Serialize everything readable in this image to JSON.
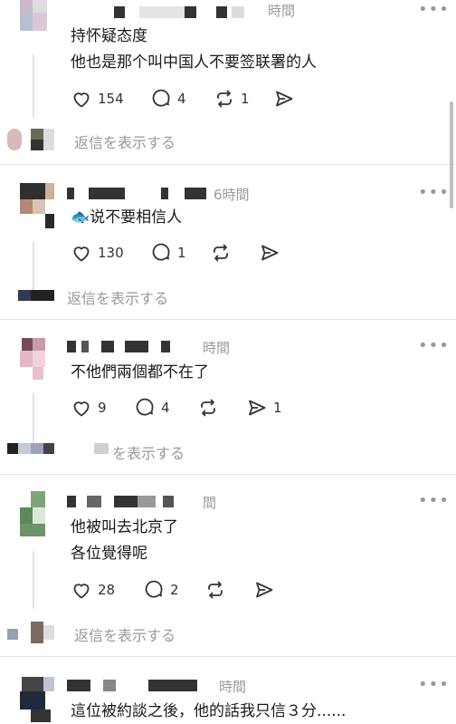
{
  "posts": [
    {
      "time": "時間",
      "text": [
        "持怀疑态度",
        "他也是那个叫中国人不要签联署的人"
      ],
      "likes": "154",
      "comments": "4",
      "reposts": "1",
      "shares": "",
      "reply": "返信を表示する"
    },
    {
      "time": "6時間",
      "text": [
        "🐟说不要相信人"
      ],
      "likes": "130",
      "comments": "1",
      "reposts": "",
      "shares": "",
      "reply": "返信を表示する"
    },
    {
      "time": "時間",
      "text": [
        "不他們兩個都不在了"
      ],
      "likes": "9",
      "comments": "4",
      "reposts": "",
      "shares": "1",
      "reply": "を表示する"
    },
    {
      "time": "間",
      "text": [
        "他被叫去北京了",
        "各位覺得呢"
      ],
      "likes": "28",
      "comments": "2",
      "reposts": "",
      "shares": "",
      "reply": "返信を表示する"
    },
    {
      "time": "時間",
      "text": [
        "這位被約談之後，他的話我只信３分......"
      ],
      "likes": "",
      "comments": "",
      "reposts": "",
      "shares": "",
      "reply": ""
    }
  ],
  "icons": {
    "more": "more-horizontal-icon",
    "like": "heart-icon",
    "comment": "comment-bubble-icon",
    "repost": "repost-icon",
    "share": "send-icon"
  },
  "colors": {
    "muted_text": "#9a9a9a",
    "divider": "#e6e6e6",
    "icon": "#333333"
  }
}
